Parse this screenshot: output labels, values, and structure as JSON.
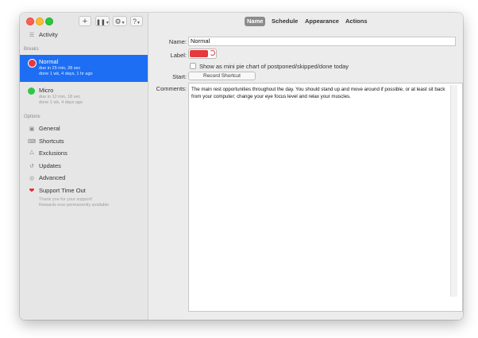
{
  "toolbar": {
    "add_icon": "plus",
    "pause_icon": "pause",
    "gear_icon": "gear",
    "help_label": "?"
  },
  "sidebar": {
    "activity_label": "Activity",
    "breaks_section": "Breaks",
    "breaks": [
      {
        "name": "Normal",
        "line1": "due in 25 min, 28 sec",
        "line2": "done 1 wk, 4 days, 1 hr ago",
        "color": "#e5393f"
      },
      {
        "name": "Micro",
        "line1": "due in 12 min, 18 sec",
        "line2": "done 1 wk, 4 days ago",
        "color": "#2ec649"
      }
    ],
    "options_section": "Options",
    "options": [
      {
        "label": "General",
        "icon": "general-icon"
      },
      {
        "label": "Shortcuts",
        "icon": "keyboard-icon"
      },
      {
        "label": "Exclusions",
        "icon": "exclusions-icon"
      },
      {
        "label": "Updates",
        "icon": "updates-icon"
      },
      {
        "label": "Advanced",
        "icon": "advanced-icon"
      },
      {
        "label": "Support Time Out",
        "icon": "heart-icon"
      }
    ],
    "support_line1": "Thank you for your support!",
    "support_line2": "Rewards now permanently available"
  },
  "tabs": [
    "Name",
    "Schedule",
    "Appearance",
    "Actions"
  ],
  "active_tab": "Name",
  "form": {
    "name_label": "Name:",
    "name_value": "Normal",
    "label_label": "Label:",
    "label_color": "#e5393f",
    "mini_pie_checkbox": "Show as mini pie chart of postponed/skipped/done today",
    "start_label": "Start:",
    "record_shortcut": "Record Shortcut",
    "comments_label": "Comments:",
    "comments_text": "The main rest opportunities throughout the day.  You should stand up and move around if possible, or at least sit back from your computer; change your eye focus level and relax your muscles."
  },
  "colors": {
    "accent": "#1d6ef3",
    "close": "#fe5f57",
    "minimize": "#febc2e",
    "maximize": "#28c840"
  }
}
